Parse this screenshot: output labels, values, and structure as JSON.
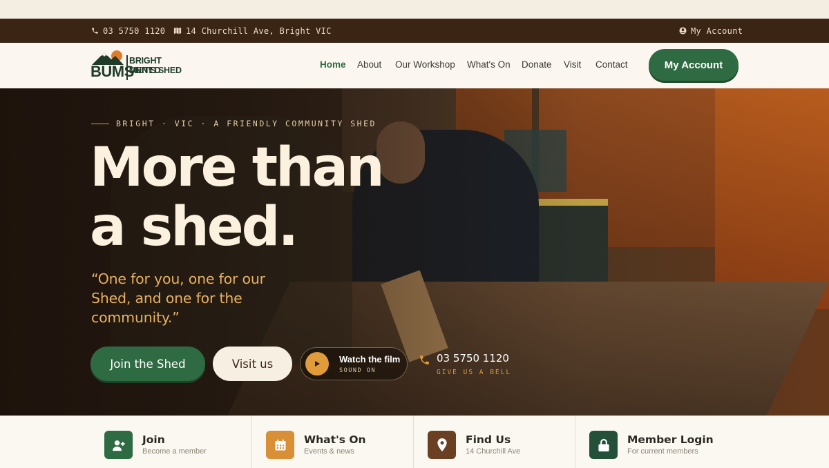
{
  "colors": {
    "topbar_bg": "#3a2515",
    "brand_green": "#2f6b42",
    "accent_orange": "#e09c3b",
    "cream": "#fbf1de"
  },
  "topbar": {
    "phone": "03 5750 1120",
    "phone_icon": "phone-icon",
    "address": "14 Churchill Ave, Bright VIC",
    "address_icon": "map-icon",
    "account": "My Account",
    "account_icon": "user-circle-icon"
  },
  "logo": {
    "mark": "BUMS",
    "line1": "BRIGHT UNITED",
    "line2": "MEN’S SHED"
  },
  "nav": {
    "items": [
      {
        "label": "Home",
        "active": true
      },
      {
        "label": "About"
      },
      {
        "label": "Our Workshop"
      },
      {
        "label": "What's On"
      },
      {
        "label": "Donate"
      },
      {
        "label": "Visit"
      },
      {
        "label": "Contact"
      }
    ],
    "account_button": "My Account"
  },
  "hero": {
    "eyebrow": "BRIGHT · VIC · A FRIENDLY COMMUNITY SHED",
    "title_line1": "More than",
    "title_line2": "a shed.",
    "quote": "“One for you, one for our Shed, and one for the community.”",
    "join_button": "Join the Shed",
    "visit_button": "Visit us",
    "film_title": "Watch the film",
    "film_sub": "SOUND ON",
    "film_icon": "play-icon",
    "phone_number": "03 5750 1120",
    "phone_sub": "GIVE US A BELL",
    "phone_icon": "phone-icon"
  },
  "cards": [
    {
      "title": "Join",
      "subtitle": "Become a member",
      "icon": "user-plus-icon",
      "color": "#2f6b42"
    },
    {
      "title": "What's On",
      "subtitle": "Events & news",
      "icon": "calendar-icon",
      "color": "#d98f35"
    },
    {
      "title": "Find Us",
      "subtitle": "14 Churchill Ave",
      "icon": "map-pin-icon",
      "color": "#6b3f22"
    },
    {
      "title": "Member Login",
      "subtitle": "For current members",
      "icon": "lock-icon",
      "color": "#24503a"
    }
  ]
}
